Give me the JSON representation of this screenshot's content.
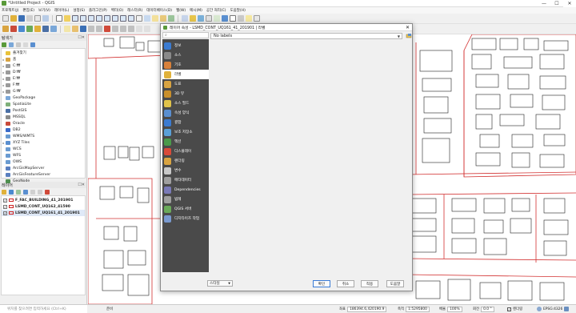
{
  "window": {
    "title": "*Untitled Project - QGIS"
  },
  "window_controls": {
    "minimize": "—",
    "maximize": "☐",
    "close": "✕"
  },
  "menu": [
    "프로젝트(J)",
    "편집(E)",
    "보기(V)",
    "레이어(L)",
    "설정(S)",
    "플러그인(P)",
    "벡터(O)",
    "래스터(R)",
    "데이터베이스(D)",
    "웹(W)",
    "메시(M)",
    "공간 처리(C)",
    "도움말(H)"
  ],
  "browser_panel": {
    "title": "탐색기",
    "items": [
      {
        "label": "즐겨찾기",
        "expand": "",
        "icon_color": "#e8c23a"
      },
      {
        "label": "홈",
        "expand": "▸",
        "icon_color": "#d9a441"
      },
      {
        "label": "C:₩",
        "expand": "▸",
        "icon_color": "#9a9a9a"
      },
      {
        "label": "D:₩",
        "expand": "▸",
        "icon_color": "#9a9a9a"
      },
      {
        "label": "E:₩",
        "expand": "▸",
        "icon_color": "#9a9a9a"
      },
      {
        "label": "F:₩",
        "expand": "▸",
        "icon_color": "#9a9a9a"
      },
      {
        "label": "G:₩",
        "expand": "▸",
        "icon_color": "#9a9a9a"
      },
      {
        "label": "GeoPackage",
        "expand": "",
        "icon_color": "#7aa7d8"
      },
      {
        "label": "SpatiaLite",
        "expand": "",
        "icon_color": "#7fb07a"
      },
      {
        "label": "PostGIS",
        "expand": "",
        "icon_color": "#4a6fa5"
      },
      {
        "label": "MSSQL",
        "expand": "",
        "icon_color": "#8a8a8a"
      },
      {
        "label": "Oracle",
        "expand": "",
        "icon_color": "#c94a3a"
      },
      {
        "label": "DB2",
        "expand": "",
        "icon_color": "#3a6bc9"
      },
      {
        "label": "WMS/WMTS",
        "expand": "",
        "icon_color": "#6a9bd1"
      },
      {
        "label": "XYZ Tiles",
        "expand": "▸",
        "icon_color": "#5a8fd0"
      },
      {
        "label": "WCS",
        "expand": "",
        "icon_color": "#6a9bd1"
      },
      {
        "label": "WFS",
        "expand": "",
        "icon_color": "#6a9bd1"
      },
      {
        "label": "OWS",
        "expand": "",
        "icon_color": "#6a9bd1"
      },
      {
        "label": "ArcGisMapServer",
        "expand": "",
        "icon_color": "#5a7fc0"
      },
      {
        "label": "ArcGisFeatureServer",
        "expand": "",
        "icon_color": "#5a7fc0"
      },
      {
        "label": "GeoNode",
        "expand": "",
        "icon_color": "#4f8f4f"
      }
    ]
  },
  "layers_panel": {
    "title": "레이어",
    "items": [
      {
        "name": "F_FAC_BUILDING_41_201901",
        "checked": true,
        "selected": false
      },
      {
        "name": "LSMD_CONT_UQ162_41590",
        "checked": true,
        "selected": false
      },
      {
        "name": "LSMD_CONT_UQ161_41_201901",
        "checked": true,
        "selected": true
      }
    ]
  },
  "locator": {
    "placeholder": "위치를 찾으려면 입력하세요 (Ctrl+K)"
  },
  "dialog": {
    "title": "레이어 속성 - LSMD_CONT_UQ161_41_201901 | 라벨",
    "search_icon": "⌕",
    "nav": [
      {
        "label": "정보",
        "icon_color": "#3b7bd1"
      },
      {
        "label": "소스",
        "icon_color": "#8a8a8a"
      },
      {
        "label": "기호",
        "icon_color": "#d9813a"
      },
      {
        "label": "라벨",
        "icon_color": "#e0b13a"
      },
      {
        "label": "도표",
        "icon_color": "#d9a441"
      },
      {
        "label": "3D 뷰",
        "icon_color": "#c98f2a"
      },
      {
        "label": "소스 필드",
        "icon_color": "#e0c34a"
      },
      {
        "label": "속성 양식",
        "icon_color": "#5a8fd0"
      },
      {
        "label": "결합",
        "icon_color": "#3b7bd1"
      },
      {
        "label": "보조 저장소",
        "icon_color": "#5aa0d8"
      },
      {
        "label": "액션",
        "icon_color": "#4a9a4a"
      },
      {
        "label": "디스플레이",
        "icon_color": "#d94a3a"
      },
      {
        "label": "렌더링",
        "icon_color": "#d9a441"
      },
      {
        "label": "변수",
        "icon_color": "#c9c9c9"
      },
      {
        "label": "메타데이터",
        "icon_color": "#a0a0a0"
      },
      {
        "label": "Dependencies",
        "icon_color": "#7a7ab8"
      },
      {
        "label": "범례",
        "icon_color": "#a0a0a0"
      },
      {
        "label": "QGIS 서버",
        "icon_color": "#6aaa5a"
      },
      {
        "label": "디지타이즈 작업",
        "icon_color": "#7a9ad0"
      }
    ],
    "active_index": 3,
    "label_mode": "No labels",
    "style_button": "스타일",
    "buttons": {
      "ok": "확인",
      "cancel": "취소",
      "apply": "적용",
      "help": "도움말"
    }
  },
  "statusbar": {
    "ready": "준비",
    "coord_label": "좌표",
    "coord_value": "186394.6,420190.9",
    "scale_label": "축척",
    "scale_value": "1:5295800",
    "magnifier_label": "배율",
    "magnifier_value": "100%",
    "rotation_label": "회전",
    "rotation_value": "0.0 °",
    "render_label": "렌더링",
    "crs": "EPSG:4326"
  }
}
